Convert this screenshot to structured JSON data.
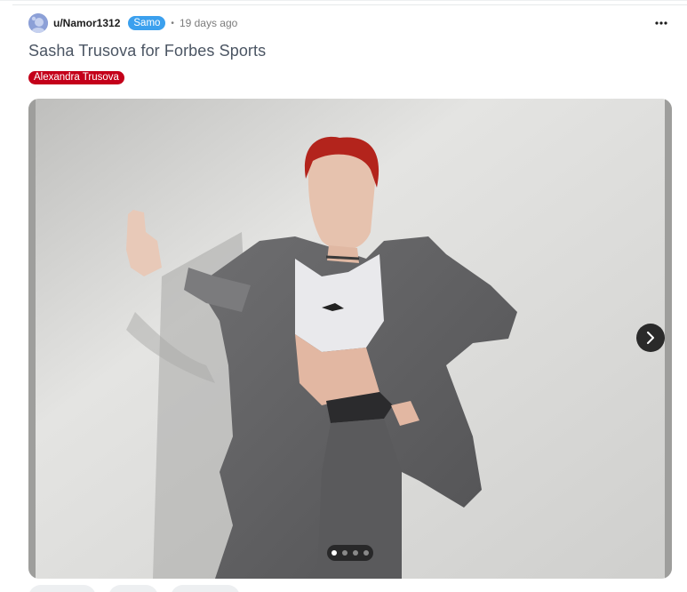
{
  "post": {
    "username": "u/Namor1312",
    "user_flair": "Samo",
    "separator": "•",
    "age": "19 days ago",
    "title": "Sasha Trusova for Forbes Sports",
    "post_flair": "Alexandra Trusova"
  },
  "gallery": {
    "total_images": 4,
    "current_index": 1
  },
  "colors": {
    "user_flair_bg": "#3ba0ee",
    "post_flair_bg": "#c4001a",
    "title": "#4b5563"
  },
  "icons": {
    "more": "more-horizontal-icon",
    "next": "chevron-right-icon",
    "avatar": "avatar-icon"
  }
}
